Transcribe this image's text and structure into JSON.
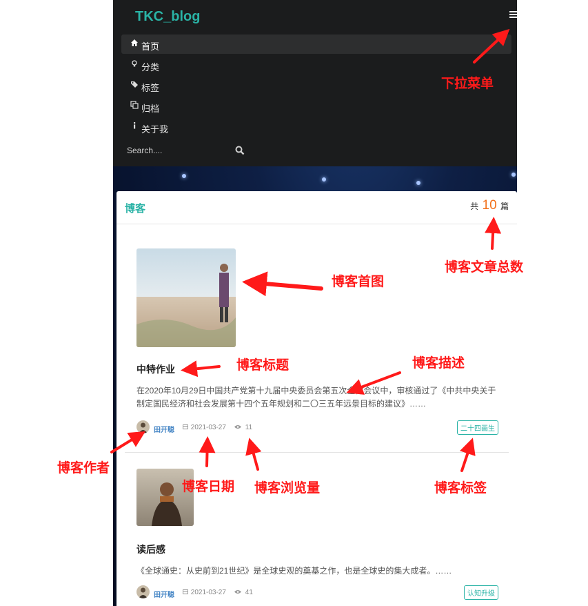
{
  "navbar": {
    "brand": "TKC_blog",
    "items": [
      {
        "icon": "home-icon",
        "label": "首页",
        "active": true
      },
      {
        "icon": "lightbulb-icon",
        "label": "分类",
        "active": false
      },
      {
        "icon": "tags-icon",
        "label": "标签",
        "active": false
      },
      {
        "icon": "clone-icon",
        "label": "归档",
        "active": false
      },
      {
        "icon": "info-icon",
        "label": "关于我",
        "active": false
      }
    ],
    "search_placeholder": "Search...."
  },
  "blog_list": {
    "title": "博客",
    "count_prefix": "共",
    "count": "10",
    "count_suffix": "篇"
  },
  "posts": [
    {
      "title": "中特作业",
      "description": "在2020年10月29日中国共产党第十九届中央委员会第五次全体会议中，审核通过了《中共中央关于制定国民经济和社会发展第十四个五年规划和二〇三五年远景目标的建议》……",
      "author": "田开聪",
      "date": "2021-03-27",
      "views": "11",
      "tag": "二十四画生"
    },
    {
      "title": "读后感",
      "description": "《全球通史：从史前到21世纪》是全球史观的奠基之作，也是全球史的集大成者。……",
      "author": "田开聪",
      "date": "2021-03-27",
      "views": "41",
      "tag": "认知升级"
    }
  ],
  "annotations": {
    "dropdown": "下拉菜单",
    "total": "博客文章总数",
    "first_image": "博客首图",
    "title": "博客标题",
    "description": "博客描述",
    "author": "博客作者",
    "date": "博客日期",
    "views": "博客浏览量",
    "tag": "博客标签"
  },
  "colors": {
    "accent": "#2ab3a6",
    "count": "#f2711c",
    "annotation": "#ff1a1a",
    "navbar": "#1b1c1d"
  }
}
